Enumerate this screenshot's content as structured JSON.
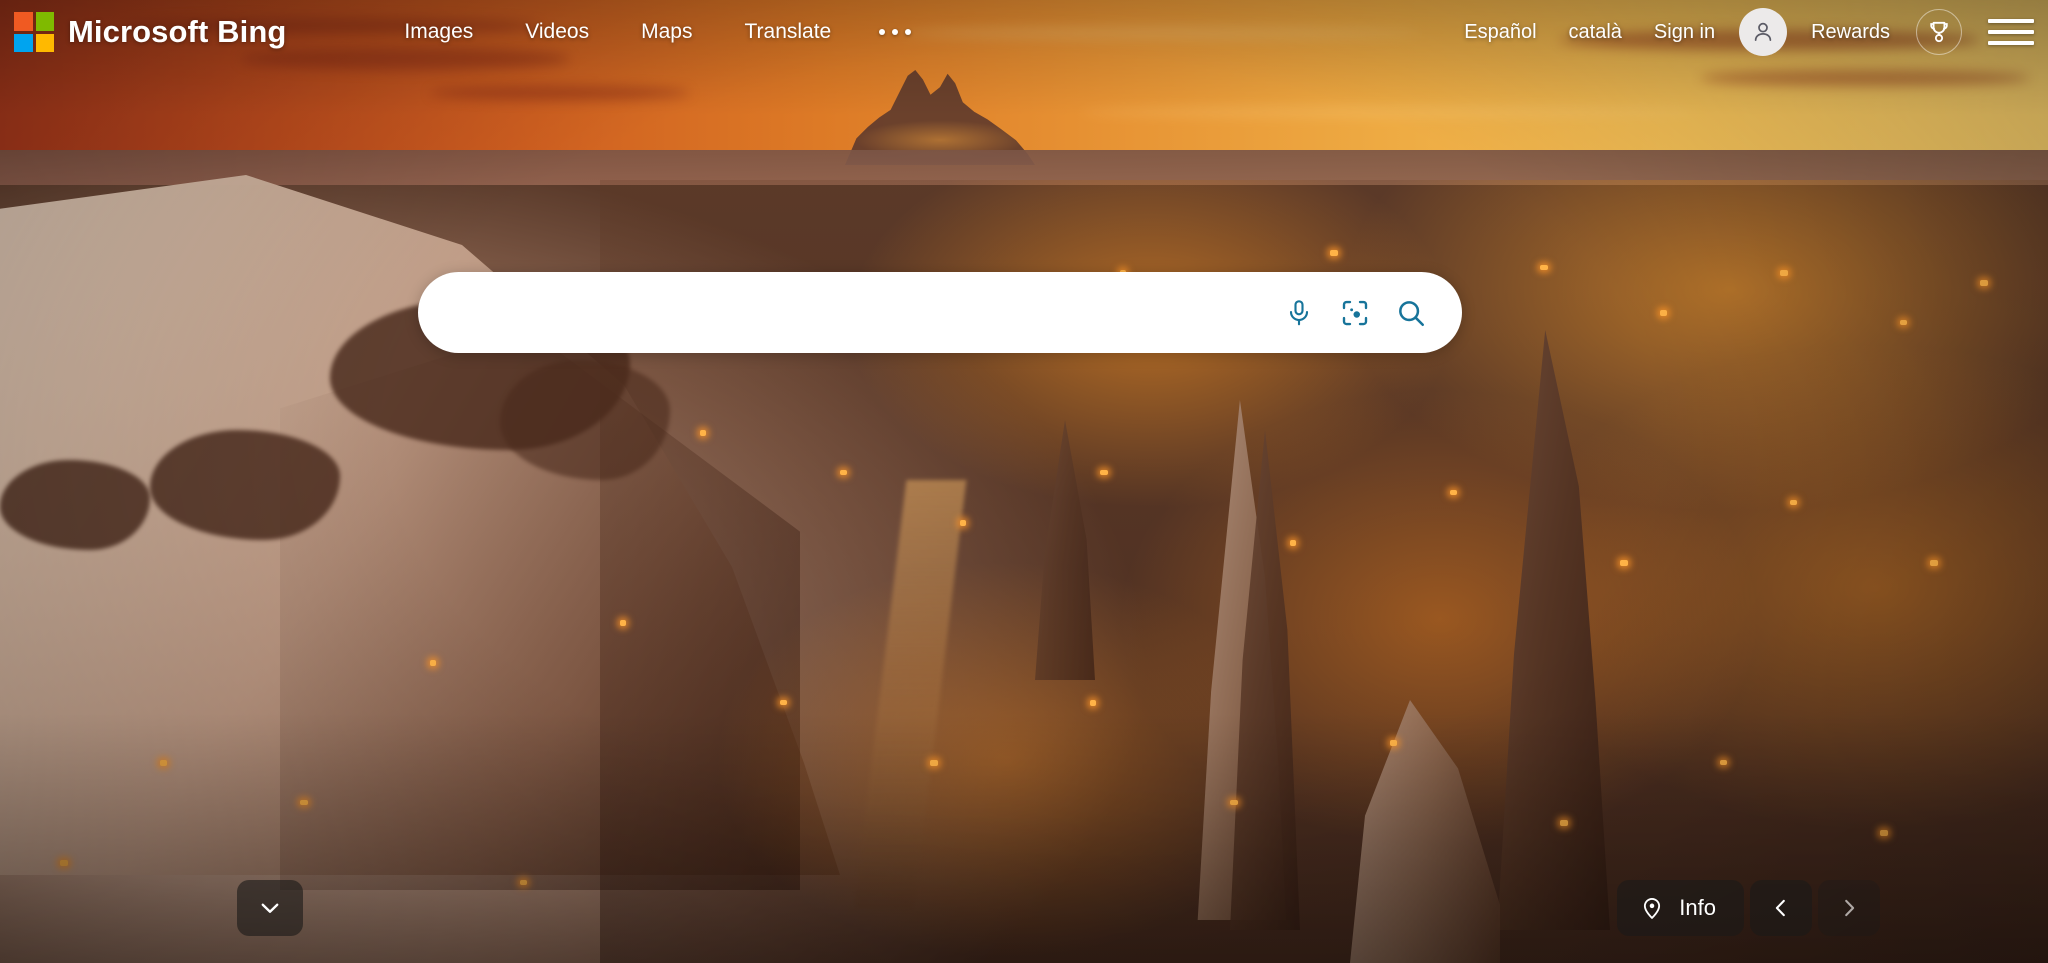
{
  "header": {
    "brand": {
      "name": "Microsoft Bing",
      "logo_icon": "microsoft-logo-icon",
      "logo_colors": {
        "top_left": "#f05a22",
        "top_right": "#7fba00",
        "bottom_left": "#00a4ef",
        "bottom_right": "#ffb900"
      }
    },
    "nav": [
      {
        "label": "Images",
        "icon": "images-link"
      },
      {
        "label": "Videos",
        "icon": "videos-link"
      },
      {
        "label": "Maps",
        "icon": "maps-link"
      },
      {
        "label": "Translate",
        "icon": "translate-link"
      }
    ],
    "more_menu": {
      "icon": "ellipsis-icon",
      "label": "More"
    },
    "right": {
      "languages": [
        {
          "label": "Español"
        },
        {
          "label": "català"
        }
      ],
      "sign_in": {
        "label": "Sign in"
      },
      "avatar": {
        "icon": "person-icon",
        "background": "#eceaea"
      },
      "rewards": {
        "label": "Rewards",
        "icon": "trophy-medal-icon"
      },
      "hamburger": {
        "icon": "hamburger-menu-icon"
      }
    }
  },
  "search": {
    "value": "",
    "placeholder": "",
    "icons": [
      {
        "name": "microphone-icon",
        "title": "Search using voice"
      },
      {
        "name": "visual-search-icon",
        "title": "Search using an image"
      },
      {
        "name": "search-magnifier-icon",
        "title": "Search"
      }
    ],
    "accent_color": "#17749a"
  },
  "bottom": {
    "scroll_down": {
      "icon": "chevron-down-icon"
    },
    "info": {
      "label": "Info",
      "icon": "location-pin-icon"
    },
    "prev": {
      "icon": "chevron-left-icon"
    },
    "next": {
      "icon": "chevron-right-icon"
    }
  },
  "background": {
    "name": "cappadocia-sunset-village-background",
    "sky_top_color": "#b4401d",
    "sky_bottom_color": "#f3c964",
    "town_light_color": "#ffb347"
  }
}
